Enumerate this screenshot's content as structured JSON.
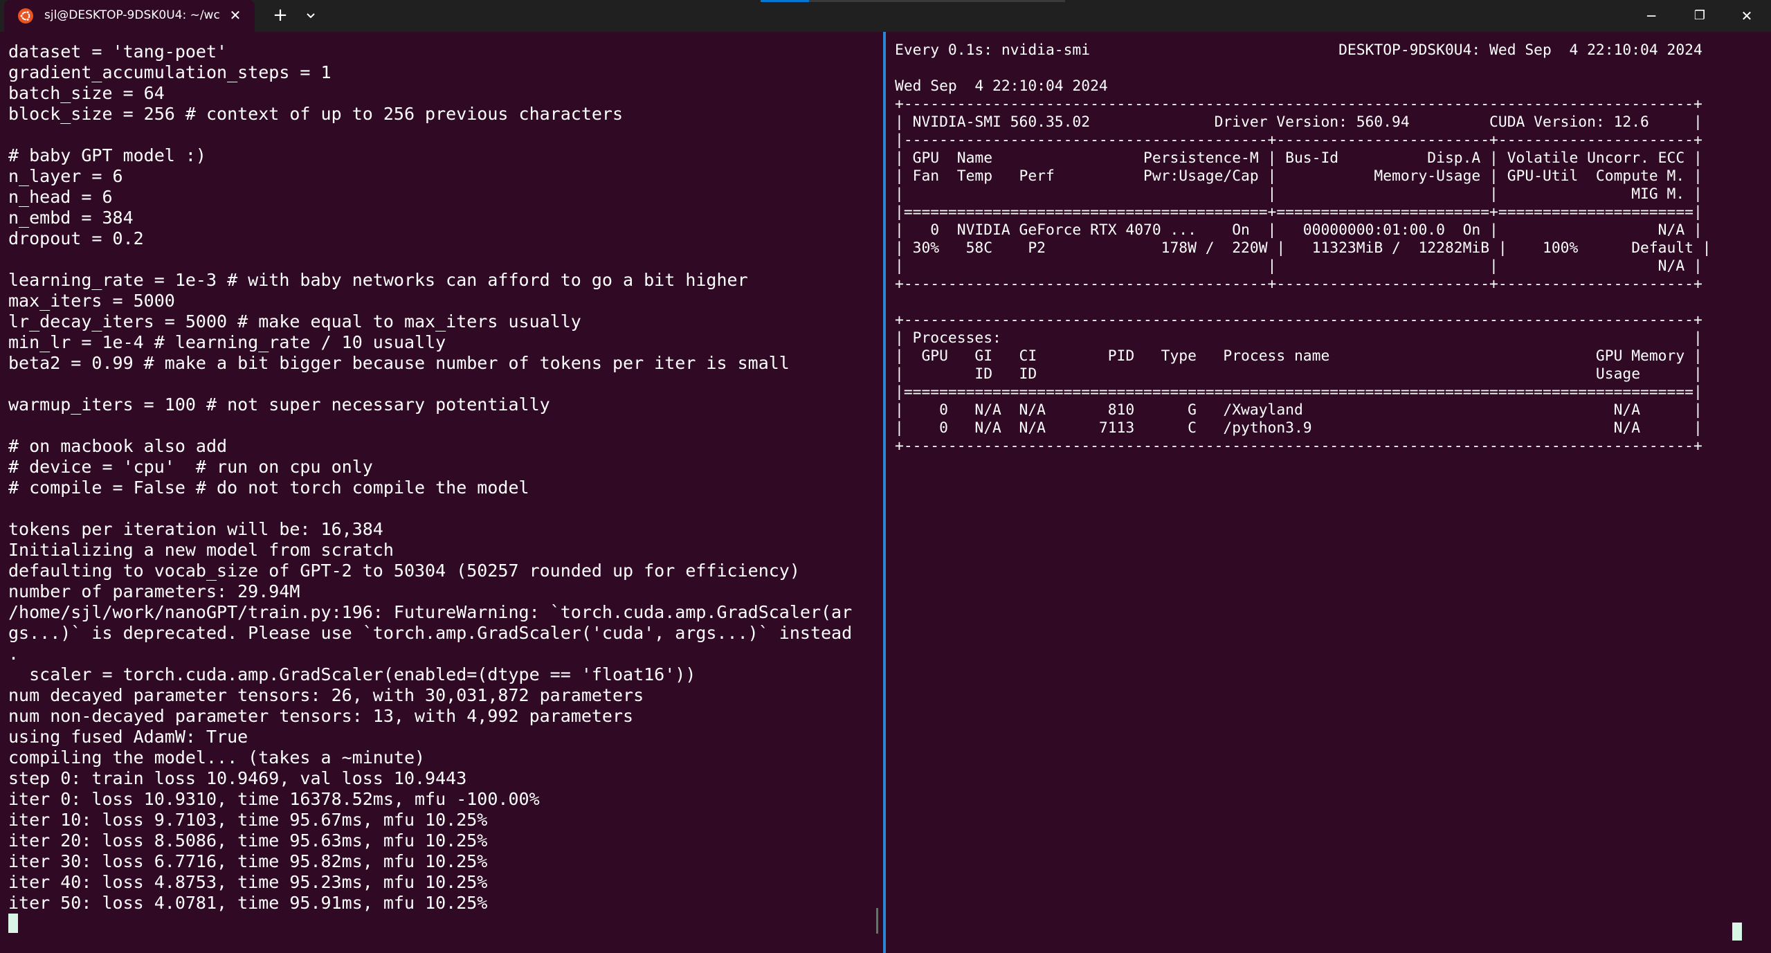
{
  "window": {
    "tab_title": "sjl@DESKTOP-9DSK0U4: ~/wc",
    "new_tab_symbol": "+",
    "dropdown_icon": "chevron-down-icon",
    "minimize_symbol": "─",
    "restore_symbol": "❐",
    "close_symbol": "✕",
    "tab_close_symbol": "✕"
  },
  "colors": {
    "terminal_bg": "#300a24",
    "titlebar_bg": "#202020",
    "divider": "#2a86d3",
    "ubuntu_orange": "#e95420",
    "cursor": "#d9f5e6"
  },
  "left_pane": {
    "lines": [
      "dataset = 'tang-poet'",
      "gradient_accumulation_steps = 1",
      "batch_size = 64",
      "block_size = 256 # context of up to 256 previous characters",
      "",
      "# baby GPT model :)",
      "n_layer = 6",
      "n_head = 6",
      "n_embd = 384",
      "dropout = 0.2",
      "",
      "learning_rate = 1e-3 # with baby networks can afford to go a bit higher",
      "max_iters = 5000",
      "lr_decay_iters = 5000 # make equal to max_iters usually",
      "min_lr = 1e-4 # learning_rate / 10 usually",
      "beta2 = 0.99 # make a bit bigger because number of tokens per iter is small",
      "",
      "warmup_iters = 100 # not super necessary potentially",
      "",
      "# on macbook also add",
      "# device = 'cpu'  # run on cpu only",
      "# compile = False # do not torch compile the model",
      "",
      "tokens per iteration will be: 16,384",
      "Initializing a new model from scratch",
      "defaulting to vocab_size of GPT-2 to 50304 (50257 rounded up for efficiency)",
      "number of parameters: 29.94M",
      "/home/sjl/work/nanoGPT/train.py:196: FutureWarning: `torch.cuda.amp.GradScaler(ar",
      "gs...)` is deprecated. Please use `torch.amp.GradScaler('cuda', args...)` instead",
      ".",
      "  scaler = torch.cuda.amp.GradScaler(enabled=(dtype == 'float16'))",
      "num decayed parameter tensors: 26, with 30,031,872 parameters",
      "num non-decayed parameter tensors: 13, with 4,992 parameters",
      "using fused AdamW: True",
      "compiling the model... (takes a ~minute)",
      "step 0: train loss 10.9469, val loss 10.9443",
      "iter 0: loss 10.9310, time 16378.52ms, mfu -100.00%",
      "iter 10: loss 9.7103, time 95.67ms, mfu 10.25%",
      "iter 20: loss 8.5086, time 95.63ms, mfu 10.25%",
      "iter 30: loss 6.7716, time 95.82ms, mfu 10.25%",
      "iter 40: loss 4.8753, time 95.23ms, mfu 10.25%",
      "iter 50: loss 4.0781, time 95.91ms, mfu 10.25%"
    ]
  },
  "right_pane": {
    "lines": [
      "Every 0.1s: nvidia-smi                            DESKTOP-9DSK0U4: Wed Sep  4 22:10:04 2024",
      "",
      "Wed Sep  4 22:10:04 2024",
      "+-----------------------------------------------------------------------------------------+",
      "| NVIDIA-SMI 560.35.02              Driver Version: 560.94         CUDA Version: 12.6     |",
      "|-----------------------------------------+------------------------+----------------------+",
      "| GPU  Name                 Persistence-M | Bus-Id          Disp.A | Volatile Uncorr. ECC |",
      "| Fan  Temp   Perf          Pwr:Usage/Cap |           Memory-Usage | GPU-Util  Compute M. |",
      "|                                         |                        |               MIG M. |",
      "|=========================================+========================+======================|",
      "|   0  NVIDIA GeForce RTX 4070 ...    On  |   00000000:01:00.0  On |                  N/A |",
      "| 30%   58C    P2             178W /  220W |   11323MiB /  12282MiB |    100%      Default |",
      "|                                         |                        |                  N/A |",
      "+-----------------------------------------+------------------------+----------------------+",
      "",
      "+-----------------------------------------------------------------------------------------+",
      "| Processes:                                                                              |",
      "|  GPU   GI   CI        PID   Type   Process name                              GPU Memory |",
      "|        ID   ID                                                               Usage      |",
      "|=========================================================================================|",
      "|    0   N/A  N/A       810      G   /Xwayland                                   N/A      |",
      "|    0   N/A  N/A      7113      C   /python3.9                                  N/A      |",
      "+-----------------------------------------------------------------------------------------+"
    ]
  }
}
